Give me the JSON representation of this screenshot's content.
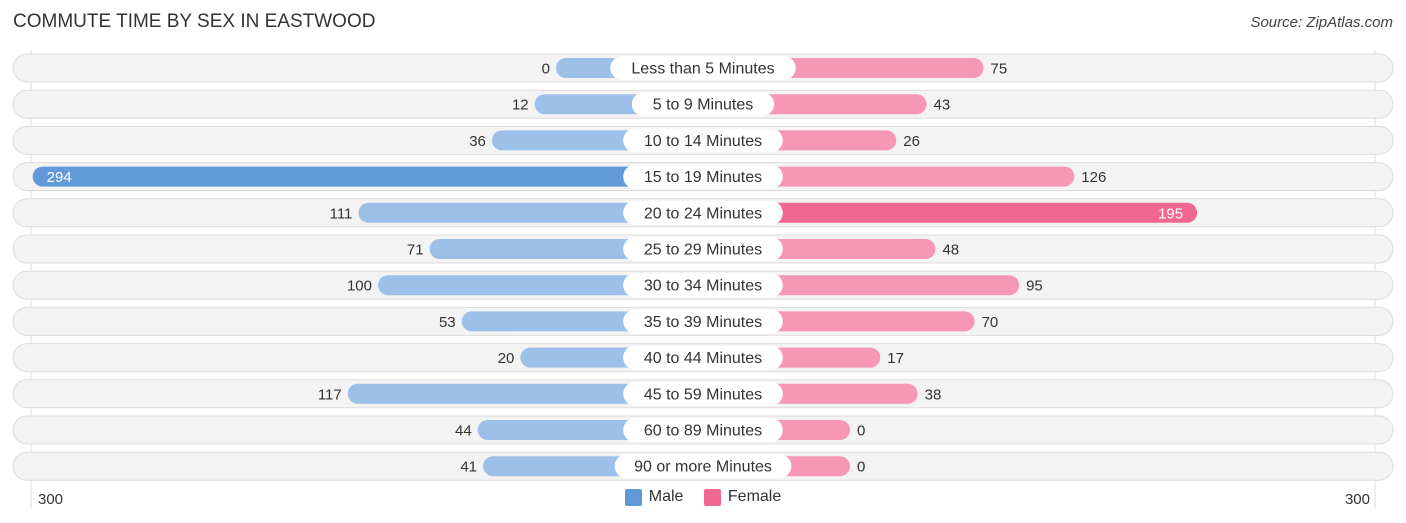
{
  "title": "COMMUTE TIME BY SEX IN EASTWOOD",
  "source": "Source: ZipAtlas.com",
  "colors": {
    "male": "#9dc0e8",
    "male_strong": "#6199d9",
    "female": "#f597b5",
    "female_strong": "#f06792"
  },
  "legend": [
    {
      "label": "Male",
      "color": "#6199d9"
    },
    {
      "label": "Female",
      "color": "#f06792"
    }
  ],
  "chart_data": {
    "type": "bar",
    "orientation": "horizontal-diverging",
    "title": "COMMUTE TIME BY SEX IN EASTWOOD",
    "categories": [
      "Less than 5 Minutes",
      "5 to 9 Minutes",
      "10 to 14 Minutes",
      "15 to 19 Minutes",
      "20 to 24 Minutes",
      "25 to 29 Minutes",
      "30 to 34 Minutes",
      "35 to 39 Minutes",
      "40 to 44 Minutes",
      "45 to 59 Minutes",
      "60 to 89 Minutes",
      "90 or more Minutes"
    ],
    "series": [
      {
        "name": "Male",
        "values": [
          0,
          12,
          36,
          294,
          111,
          71,
          100,
          53,
          20,
          117,
          44,
          41
        ]
      },
      {
        "name": "Female",
        "values": [
          75,
          43,
          26,
          126,
          195,
          48,
          95,
          70,
          17,
          38,
          0,
          0
        ]
      }
    ],
    "axis": {
      "left_label": "300",
      "right_label": "300",
      "max": 300
    },
    "legend_position": "bottom-center"
  }
}
